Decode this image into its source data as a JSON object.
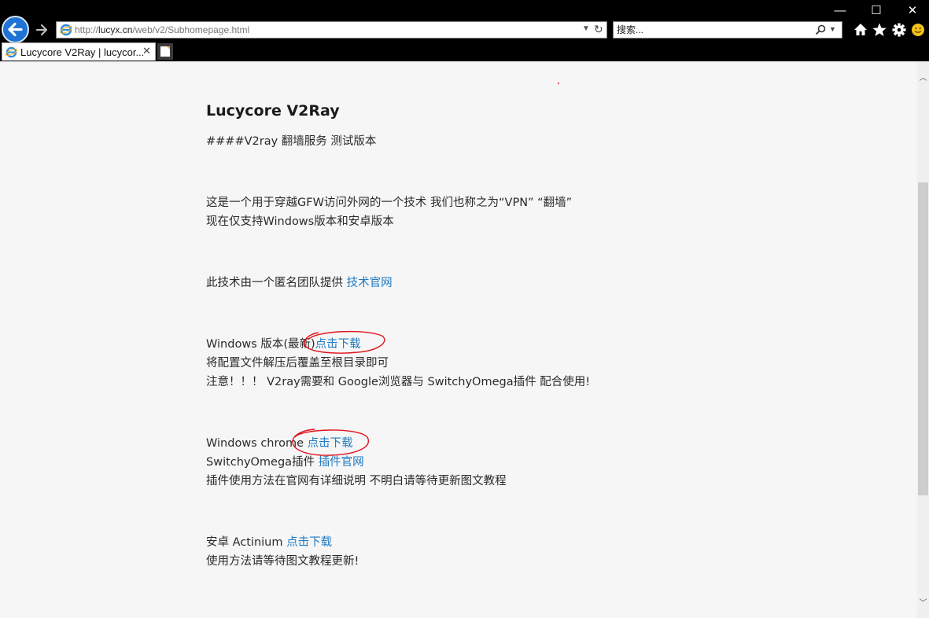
{
  "browser": {
    "address": {
      "prefix": "http://",
      "host": "lucyx.cn",
      "path": "/web/v2/Subhomepage.html"
    },
    "search_placeholder": "搜索...",
    "tab_title": "Lucycore V2Ray | lucycor...",
    "window_controls": {
      "minimize": "—",
      "maximize": "☐",
      "close": "✕"
    },
    "icons": [
      "back-arrow-icon",
      "forward-arrow-icon",
      "ie-logo-icon",
      "refresh-icon",
      "search-icon",
      "home-icon",
      "favorites-star-icon",
      "settings-gear-icon",
      "smiley-feedback-icon"
    ]
  },
  "page": {
    "title": "Lucycore V2Ray",
    "subtitle": "####V2ray 翻墙服务 测试版本",
    "intro1": "这是一个用于穿越GFW访问外网的一个技术 我们也称之为“VPN” “翻墙”",
    "intro2": "现在仅支持Windows版本和安卓版本",
    "team_text": "此技术由一个匿名团队提供 ",
    "team_link": "技术官网",
    "win_text": "Windows 版本(最新)",
    "win_link": "点击下载",
    "win_note1": "将配置文件解压后覆盖至根目录即可",
    "win_note2": "注意！！！ V2ray需要和 Google浏览器与 SwitchyOmega插件 配合使用!",
    "chrome_text": "Windows chrome ",
    "chrome_link": "点击下载",
    "omega_text": "SwitchyOmega插件 ",
    "omega_link": "插件官网",
    "omega_note": "插件使用方法在官网有详细说明 不明白请等待更新图文教程",
    "android_text": "安卓 Actinium ",
    "android_link": "点击下载",
    "android_note": "使用方法请等待图文教程更新!"
  },
  "colors": {
    "link": "#1f7ac2",
    "annotation": "#e0141e",
    "chrome_bg": "#000000",
    "page_bg": "#f6f6f6"
  }
}
